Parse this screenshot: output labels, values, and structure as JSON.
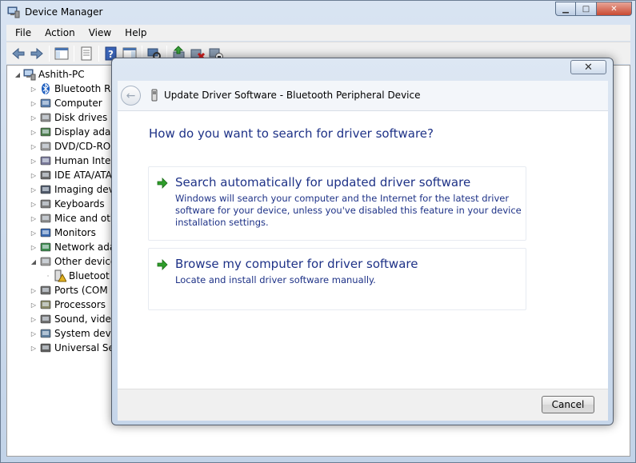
{
  "window": {
    "title": "Device Manager",
    "buttons": {
      "minimize": "▁",
      "maximize": "□",
      "close": "✕"
    }
  },
  "menu": [
    "File",
    "Action",
    "View",
    "Help"
  ],
  "tree": {
    "root": "Ashith-PC",
    "items": [
      {
        "label": "Bluetooth Ra",
        "icon": "bluetooth-icon",
        "state": "collapsed"
      },
      {
        "label": "Computer",
        "icon": "computer-icon",
        "state": "collapsed"
      },
      {
        "label": "Disk drives",
        "icon": "disk-drive-icon",
        "state": "collapsed"
      },
      {
        "label": "Display adap",
        "icon": "display-adapter-icon",
        "state": "collapsed"
      },
      {
        "label": "DVD/CD-RO",
        "icon": "dvd-drive-icon",
        "state": "collapsed"
      },
      {
        "label": "Human Inter",
        "icon": "hid-icon",
        "state": "collapsed"
      },
      {
        "label": "IDE ATA/ATA",
        "icon": "ide-controller-icon",
        "state": "collapsed"
      },
      {
        "label": "Imaging dev",
        "icon": "camera-icon",
        "state": "collapsed"
      },
      {
        "label": "Keyboards",
        "icon": "keyboard-icon",
        "state": "collapsed"
      },
      {
        "label": "Mice and oth",
        "icon": "mouse-icon",
        "state": "collapsed"
      },
      {
        "label": "Monitors",
        "icon": "monitor-icon",
        "state": "collapsed"
      },
      {
        "label": "Network ada",
        "icon": "network-adapter-icon",
        "state": "collapsed"
      },
      {
        "label": "Other device",
        "icon": "unknown-device-icon",
        "state": "expanded"
      },
      {
        "label": "Bluetoot",
        "icon": "warning-device-icon",
        "state": "child"
      },
      {
        "label": "Ports (COM",
        "icon": "port-icon",
        "state": "collapsed"
      },
      {
        "label": "Processors",
        "icon": "processor-icon",
        "state": "collapsed"
      },
      {
        "label": "Sound, vide",
        "icon": "speaker-icon",
        "state": "collapsed"
      },
      {
        "label": "System devi",
        "icon": "system-device-icon",
        "state": "collapsed"
      },
      {
        "label": "Universal Se",
        "icon": "usb-icon",
        "state": "collapsed"
      }
    ]
  },
  "dialog": {
    "close_label": "✕",
    "back_label": "←",
    "title": "Update Driver Software - Bluetooth Peripheral Device",
    "question": "How do you want to search for driver software?",
    "options": [
      {
        "title": "Search automatically for updated driver software",
        "desc": "Windows will search your computer and the Internet for the latest driver software for your device, unless you've disabled this feature in your device installation settings."
      },
      {
        "title": "Browse my computer for driver software",
        "desc": "Locate and install driver software manually."
      }
    ],
    "cancel_label": "Cancel"
  },
  "colors": {
    "link_blue": "#1e3287",
    "arrow_green": "#2e9e2a",
    "frame_blue": "#c2d3e8"
  }
}
